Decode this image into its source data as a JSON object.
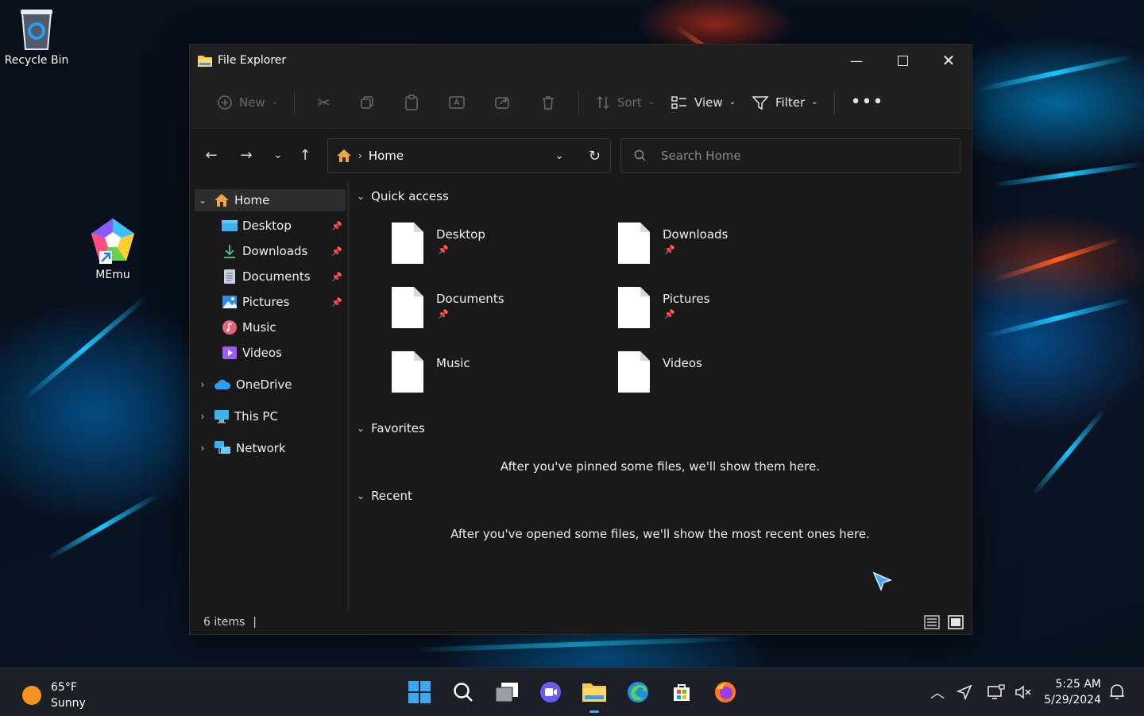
{
  "desktop": {
    "icons": [
      {
        "label": "Recycle Bin",
        "icon": "recycle-bin-icon"
      },
      {
        "label": "MEmu",
        "icon": "memu-icon"
      }
    ]
  },
  "window": {
    "title": "File Explorer",
    "controls": [
      "minimize",
      "maximize",
      "close"
    ]
  },
  "toolbar": {
    "new_label": "New",
    "sort_label": "Sort",
    "view_label": "View",
    "filter_label": "Filter"
  },
  "nav": {
    "address_label": "Home",
    "search_placeholder": "Search Home"
  },
  "sidebar": {
    "items": [
      {
        "label": "Home",
        "pinned": false
      },
      {
        "label": "Desktop",
        "pinned": true
      },
      {
        "label": "Downloads",
        "pinned": true
      },
      {
        "label": "Documents",
        "pinned": true
      },
      {
        "label": "Pictures",
        "pinned": true
      },
      {
        "label": "Music",
        "pinned": false
      },
      {
        "label": "Videos",
        "pinned": false
      },
      {
        "label": "OneDrive",
        "pinned": false
      },
      {
        "label": "This PC",
        "pinned": false
      },
      {
        "label": "Network",
        "pinned": false
      }
    ]
  },
  "content": {
    "quick_access_title": "Quick access",
    "tiles": [
      {
        "label": "Desktop",
        "pinned": true
      },
      {
        "label": "Downloads",
        "pinned": true
      },
      {
        "label": "Documents",
        "pinned": true
      },
      {
        "label": "Pictures",
        "pinned": true
      },
      {
        "label": "Music",
        "pinned": false
      },
      {
        "label": "Videos",
        "pinned": false
      }
    ],
    "favorites_title": "Favorites",
    "favorites_empty": "After you've pinned some files, we'll show them here.",
    "recent_title": "Recent",
    "recent_empty": "After you've opened some files, we'll show the most recent ones here."
  },
  "status": {
    "items_count": "6 items"
  },
  "taskbar": {
    "weather_temp": "65°F",
    "weather_desc": "Sunny",
    "time": "5:25 AM",
    "date": "5/29/2024"
  },
  "colors": {
    "window_bg": "#191919",
    "accent_blue": "#19c6ff",
    "folder_yellow": "#f4c84a"
  }
}
